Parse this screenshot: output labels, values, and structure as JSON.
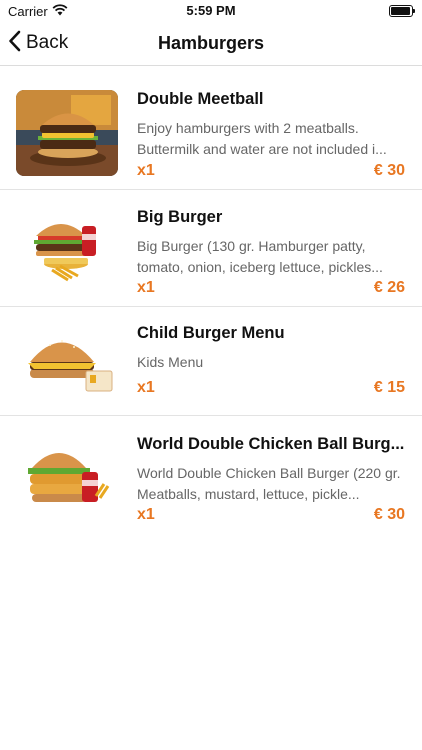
{
  "status": {
    "carrier": "Carrier",
    "time": "5:59 PM",
    "battery_level": 0.95
  },
  "nav": {
    "back_label": "Back",
    "title": "Hamburgers"
  },
  "items": [
    {
      "name": "Double Meetball",
      "description": "Enjoy hamburgers with 2 meatballs. Buttermilk and water are not included i...",
      "qty": "x1",
      "price": "€ 30"
    },
    {
      "name": "Big Burger",
      "description": "Big Burger (130 gr. Hamburger patty, tomato, onion, iceberg lettuce, pickles...",
      "qty": "x1",
      "price": "€ 26"
    },
    {
      "name": "Child Burger Menu",
      "description": "Kids Menu",
      "qty": "x1",
      "price": "€ 15"
    },
    {
      "name": "World Double Chicken Ball Burg...",
      "description": "World Double Chicken Ball Burger (220 gr. Meatballs, mustard, lettuce, pickle...",
      "qty": "x1",
      "price": "€ 30"
    }
  ],
  "colors": {
    "accent": "#e87722",
    "text": "#111111",
    "secondary_text": "#666666",
    "divider": "#e3e3e3"
  }
}
